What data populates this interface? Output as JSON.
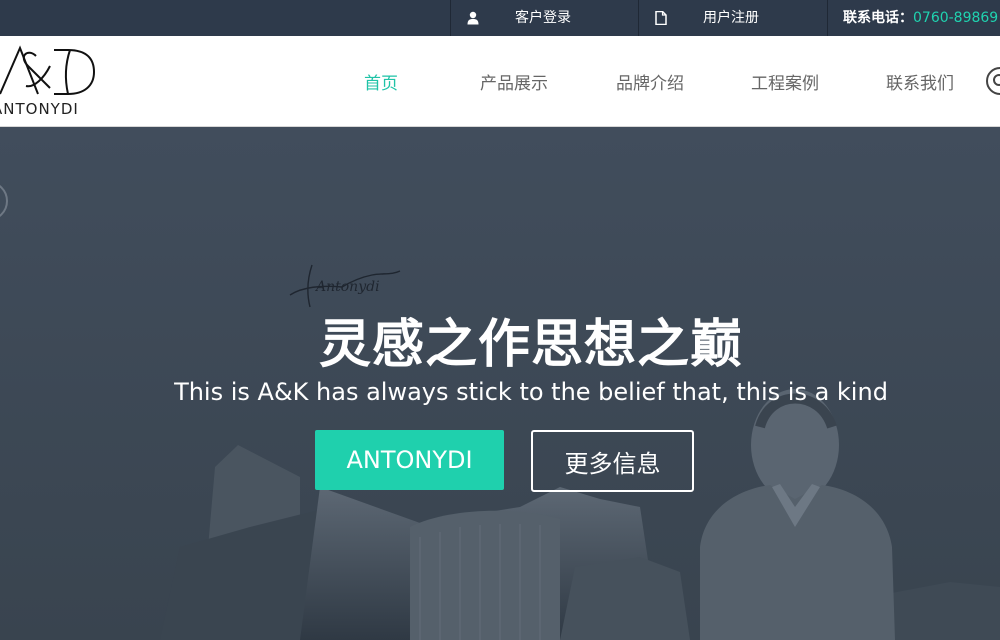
{
  "topbar": {
    "login_label": "客户登录",
    "register_label": "用户注册",
    "phone_label": "联系电话：",
    "phone_number": "0760-89869",
    "login_icon": "user-icon",
    "register_icon": "file-icon"
  },
  "header": {
    "logo_mark": "A&D",
    "logo_text": "ANTONYDI",
    "nav": [
      {
        "label": "首页",
        "active": true
      },
      {
        "label": "产品展示",
        "active": false
      },
      {
        "label": "品牌介绍",
        "active": false
      },
      {
        "label": "工程案例",
        "active": false
      },
      {
        "label": "联系我们",
        "active": false
      }
    ],
    "search_icon": "search-icon"
  },
  "hero": {
    "title": "灵感之作思想之巅",
    "subtitle": "This is A&K has always stick to the belief that, this is a kind",
    "primary_button": "ANTONYDI",
    "secondary_button": "更多信息",
    "signature_text": "Antonydi"
  },
  "colors": {
    "accent": "#1fd0ad",
    "topbar_bg": "#2e3a4b",
    "hero_bg": "#3e4a59"
  }
}
